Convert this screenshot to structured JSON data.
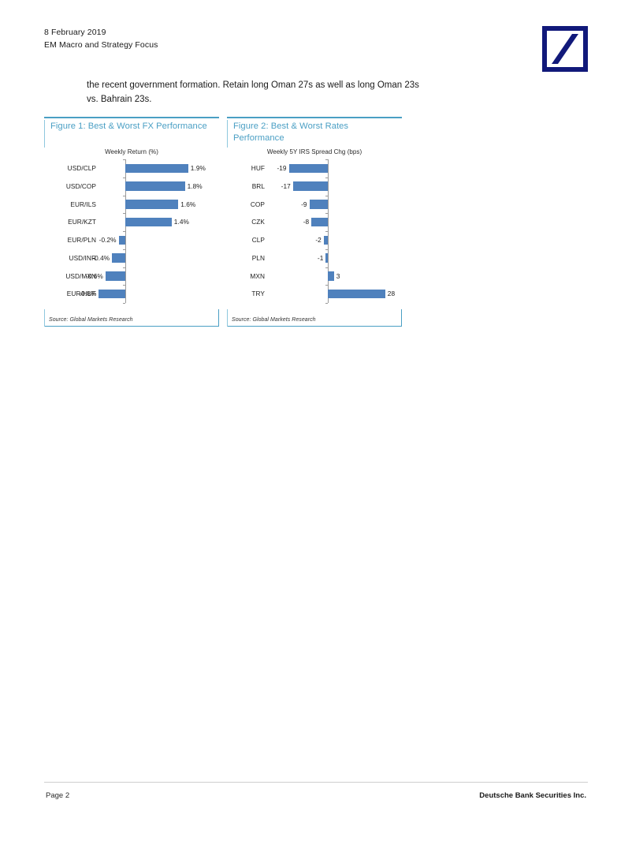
{
  "header": {
    "date": "8 February 2019",
    "title": "EM Macro and Strategy Focus",
    "logo_name": "deutsche-bank-logo",
    "logo_color": "#11197a"
  },
  "body": {
    "paragraph": "the recent government formation. Retain long Oman 27s as well as long Oman 23s vs. Bahrain 23s."
  },
  "figures": [
    {
      "title": "Figure 1: Best & Worst FX Performance",
      "source": "Source: Global Markets Research"
    },
    {
      "title": "Figure 2: Best & Worst Rates Performance",
      "source": "Source: Global Markets Research"
    }
  ],
  "footer": {
    "page": "Page 2",
    "entity": "Deutsche Bank Securities Inc."
  },
  "theme": {
    "bar_color": "#4f81bd",
    "title_color": "#4a9fc4",
    "border_color": "#4a9fc4",
    "axis_color": "#9a9a9a"
  },
  "chart_data": [
    {
      "type": "bar",
      "orientation": "horizontal",
      "title": "Figure 1: Best & Worst FX Performance",
      "subtitle": "Weekly Return (%)",
      "xlabel": "",
      "ylabel": "",
      "categories": [
        "USD/CLP",
        "USD/COP",
        "EUR/ILS",
        "EUR/KZT",
        "EUR/PLN",
        "USD/INR",
        "USD/MXN",
        "EUR/HUF"
      ],
      "values": [
        1.9,
        1.8,
        1.6,
        1.4,
        -0.2,
        -0.4,
        -0.6,
        -0.8
      ],
      "data_labels": [
        "1.9%",
        "1.8%",
        "1.6%",
        "1.4%",
        "-0.2%",
        "-0.4%",
        "-0.6%",
        "-0.8%"
      ],
      "xlim": [
        -1.0,
        2.2
      ],
      "grid": false,
      "legend": false,
      "series_color": "#4f81bd",
      "source": "Source: Global Markets Research"
    },
    {
      "type": "bar",
      "orientation": "horizontal",
      "title": "Figure 2: Best & Worst Rates Performance",
      "subtitle": "Weekly 5Y IRS  Spread Chg (bps)",
      "xlabel": "",
      "ylabel": "",
      "categories": [
        "HUF",
        "BRL",
        "COP",
        "CZK",
        "CLP",
        "PLN",
        "MXN",
        "TRY"
      ],
      "values": [
        -19,
        -17,
        -9,
        -8,
        -2,
        -1,
        3,
        28
      ],
      "data_labels": [
        "-19",
        "-17",
        "-9",
        "-8",
        "-2",
        "-1",
        "3",
        "28"
      ],
      "xlim": [
        -24,
        34
      ],
      "grid": false,
      "legend": false,
      "series_color": "#4f81bd",
      "source": "Source: Global Markets Research"
    }
  ]
}
